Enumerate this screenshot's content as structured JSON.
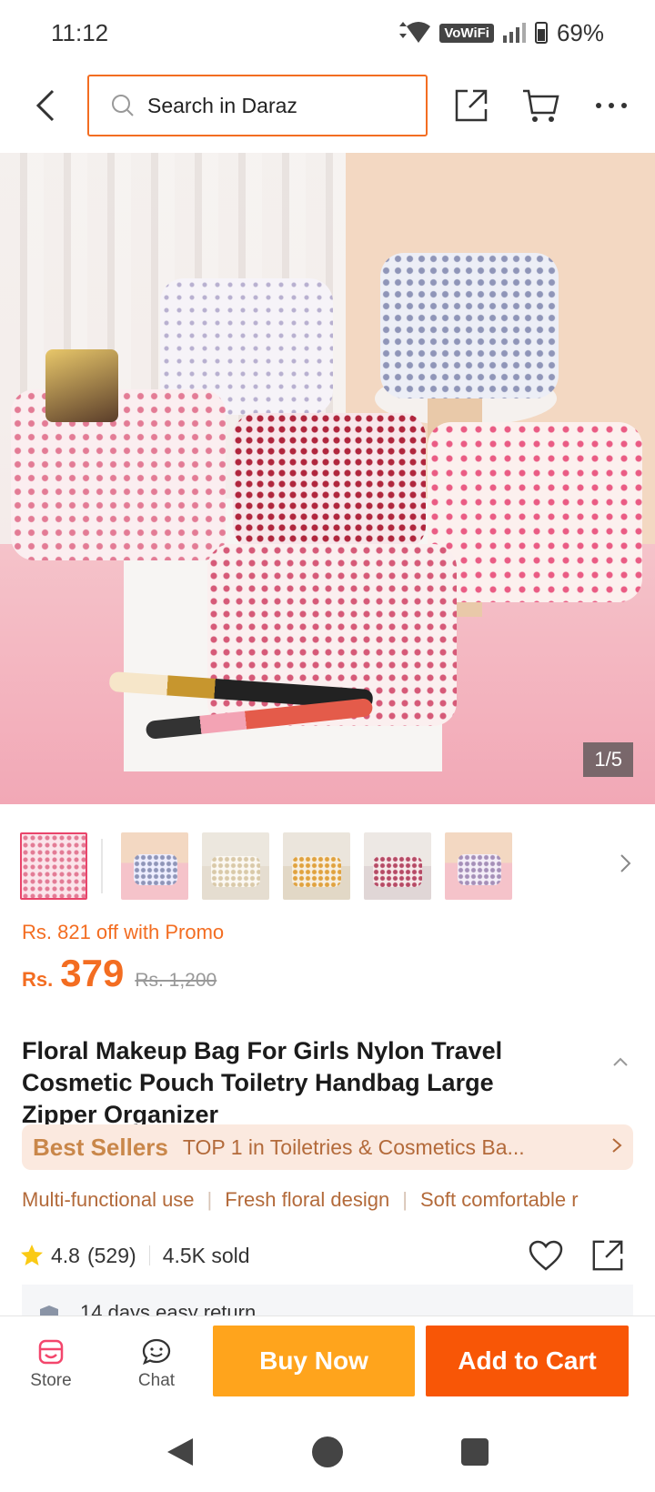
{
  "status_bar": {
    "time": "11:12",
    "network_label": "VoWiFi",
    "battery": "69%"
  },
  "header": {
    "search_placeholder": "Search in Daraz",
    "icons": [
      "back-icon",
      "search-icon",
      "share-icon",
      "cart-icon",
      "more-icon"
    ]
  },
  "gallery": {
    "counter": "1/5",
    "thumbnail_count": 6,
    "active_thumbnail": 0
  },
  "price": {
    "promo": "Rs. 821 off with Promo",
    "currency": "Rs.",
    "current": "379",
    "original": "Rs. 1,200"
  },
  "product": {
    "title": "Floral Makeup Bag For Girls Nylon Travel Cosmetic Pouch Toiletry Handbag Large Zipper Organizer"
  },
  "best_sellers": {
    "badge": "Best Sellers",
    "text": "TOP 1 in Toiletries & Cosmetics Ba..."
  },
  "highlights": [
    "Multi-functional use",
    "Fresh floral design",
    "Soft comfortable r"
  ],
  "rating": {
    "score": "4.8",
    "reviews": "(529)",
    "sold": "4.5K sold"
  },
  "return_policy": {
    "text": "14 days easy return"
  },
  "bottom_bar": {
    "store_label": "Store",
    "chat_label": "Chat",
    "buy_now_label": "Buy Now",
    "add_to_cart_label": "Add to Cart"
  },
  "colors": {
    "accent": "#f36d21",
    "buy_now": "#ffa41c",
    "add_to_cart": "#f85606",
    "active_thumb_border": "#e9446a"
  }
}
